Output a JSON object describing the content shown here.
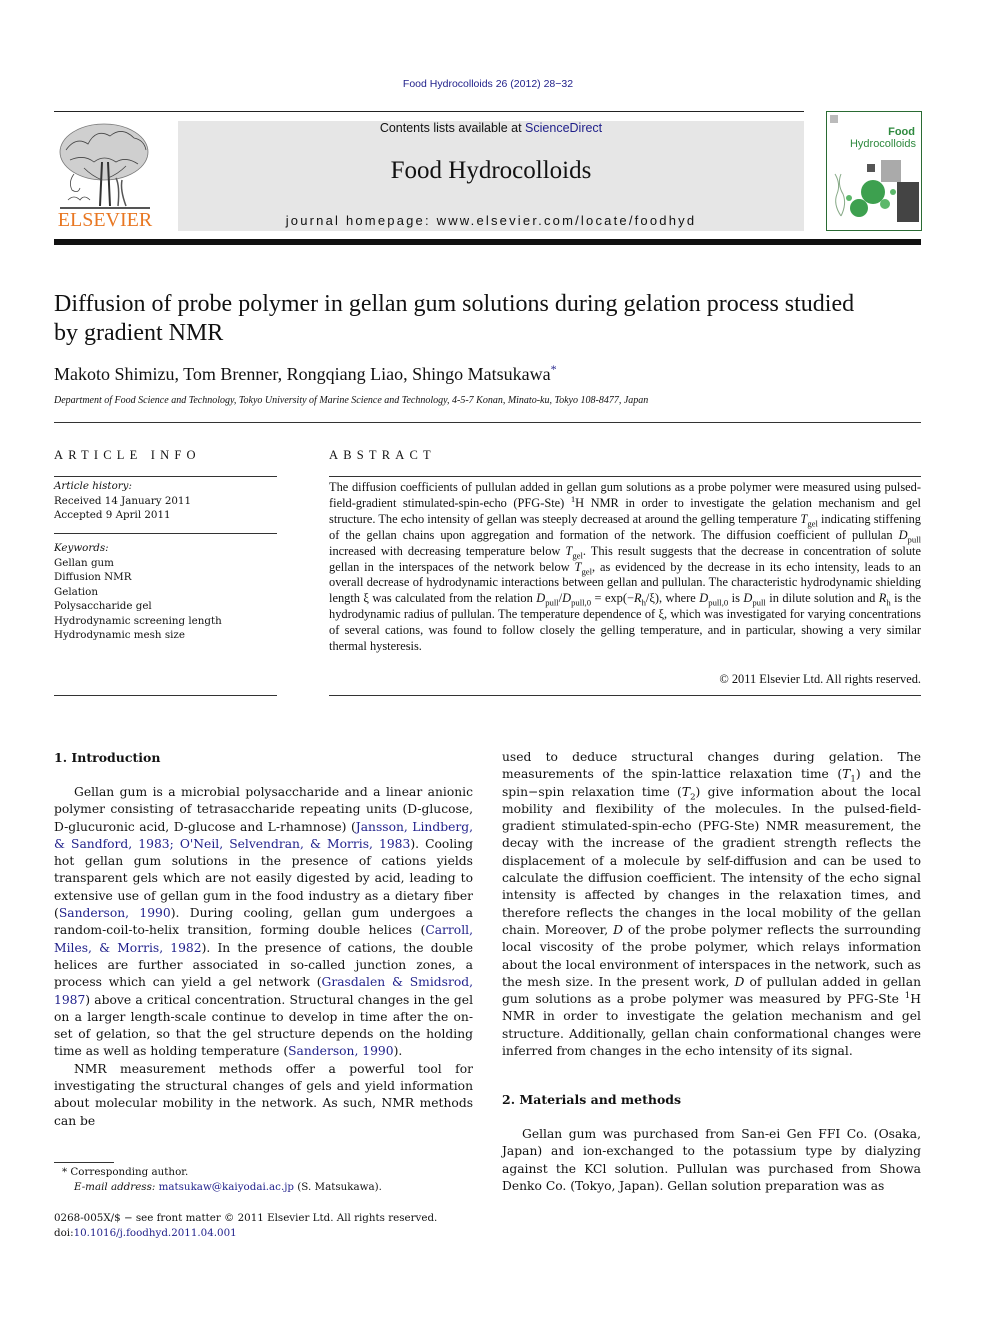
{
  "header": {
    "citation": "Food Hydrocolloids 26 (2012) 28−32",
    "contents_prefix": "Contents lists available at ",
    "contents_link": "ScienceDirect",
    "journal_title": "Food Hydrocolloids",
    "homepage": "journal homepage: www.elsevier.com/locate/foodhyd",
    "publisher_logo_text": "ELSEVIER",
    "cover_title_line1": "Food",
    "cover_title_line2": "Hydrocolloids"
  },
  "article": {
    "title": "Diffusion of probe polymer in gellan gum solutions during gelation process studied by gradient NMR",
    "authors": "Makoto Shimizu, Tom Brenner, Rongqiang Liao, Shingo Matsukawa",
    "corresponding_mark": "*",
    "affiliation": "Department of Food Science and Technology, Tokyo University of Marine Science and Technology, 4-5-7 Konan, Minato-ku, Tokyo 108-8477, Japan"
  },
  "article_info": {
    "label": "ARTICLE INFO",
    "history_label": "Article history:",
    "received": "Received 14 January 2011",
    "accepted": "Accepted 9 April 2011",
    "keywords_label": "Keywords:",
    "keywords": [
      "Gellan gum",
      "Diffusion NMR",
      "Gelation",
      "Polysaccharide gel",
      "Hydrodynamic screening length",
      "Hydrodynamic mesh size"
    ]
  },
  "abstract": {
    "label": "ABSTRACT",
    "s1": "The diffusion coefficients of pullulan added in gellan gum solutions as a probe polymer were measured using pulsed-field-gradient stimulated-spin-echo (PFG-Ste) ",
    "s1_sup": "1",
    "s2": "H NMR in order to investigate the gelation mechanism and gel structure. The echo intensity of gellan was steeply decreased at around the gelling temperature ",
    "s3": " indicating stiffening of the gellan chains upon aggregation and formation of the network. The diffusion coefficient of pullulan ",
    "s4": " increased with decreasing temperature below ",
    "s5": ". This result suggests that the decrease in concentration of solute gellan in the interspaces of the network below ",
    "s6": ", as evidenced by the decrease in its echo intensity, leads to an overall decrease of hydrodynamic interactions between gellan and pullulan. The characteristic hydrodynamic shielding length ξ was calculated from the relation ",
    "s7": ", where ",
    "s8": " is ",
    "s9": " in dilute solution and ",
    "s10": " is the hydrodynamic radius of pullulan. The temperature dependence of ξ, which was investigated for varying concentrations of several cations, was found to follow closely the gelling temperature, and in particular, showing a very similar thermal hysteresis.",
    "sym_T": "T",
    "sub_gel": "gel",
    "sym_D": "D",
    "sub_pull": "pull",
    "sub_pull0": "pull,0",
    "relation_mid": " = exp(−",
    "relation_end": "/ξ)",
    "sym_R": "R",
    "sub_h": "h",
    "copyright": "© 2011 Elsevier Ltd. All rights reserved."
  },
  "intro": {
    "heading": "1.  Introduction",
    "p1_a": "Gellan gum is a microbial polysaccharide and a linear anionic polymer consisting of tetrasaccharide repeating units (D-glucose, D-glucuronic acid, D-glucose and L-rhamnose) (",
    "p1_ref1": "Jansson, Lindberg, & Sandford, 1983; O'Neil, Selvendran, & Morris, 1983",
    "p1_b": "). Cooling hot gellan gum solutions in the presence of cations yields transparent gels which are not easily digested by acid, leading to extensive use of gellan gum in the food industry as a dietary fiber (",
    "p1_ref2": "Sanderson, 1990",
    "p1_c": "). During cooling, gellan gum undergoes a random-coil-to-helix transition, forming double helices (",
    "p1_ref3": "Carroll, Miles, & Morris, 1982",
    "p1_d": "). In the presence of cations, the double helices are further associated in so-called junction zones, a process which can yield a gel network (",
    "p1_ref4": "Grasdalen & Smidsrod, 1987",
    "p1_e": ") above a critical concentration. Structural changes in the gel on a larger length-scale continue to develop in time after the on-set of gelation, so that the gel structure depends on the holding time as well as holding temperature (",
    "p1_ref5": "Sanderson, 1990",
    "p1_f": ").",
    "p2": "NMR measurement methods offer a powerful tool for investigating the structural changes of gels and yield information about molecular mobility in the network. As such, NMR methods can be",
    "p3_a": "used to deduce structural changes during gelation. The measurements of the spin-lattice relaxation time (",
    "p3_b": ") and the spin−spin relaxation time (",
    "p3_c": ") give information about the local mobility and flexibility of the molecules. In the pulsed-field-gradient stimulated-spin-echo (PFG-Ste) NMR measurement, the decay with the increase of the gradient strength reflects the displacement of a molecule by self-diffusion and can be used to calculate the diffusion coefficient. The intensity of the echo signal intensity is affected by changes in the relaxation times, and therefore reflects the changes in the local mobility of the gellan chain. Moreover, ",
    "p3_d": " of the probe polymer reflects the surrounding local viscosity of the probe polymer, which relays information about the local environment of interspaces in the network, such as the mesh size. In the present work, ",
    "p3_e": " of pullulan added in gellan gum solutions as a probe polymer was measured by PFG-Ste ",
    "p3_f": "H NMR in order to investigate the gelation mechanism and gel structure. Additionally, gellan chain conformational changes were inferred from changes in the echo intensity of its signal.",
    "sub_1": "1",
    "sub_2": "2",
    "sup_1": "1"
  },
  "methods": {
    "heading": "2.  Materials and methods",
    "p1": "Gellan gum was purchased from San-ei Gen FFI Co. (Osaka, Japan) and ion-exchanged to the potassium type by dialyzing against the KCl solution. Pullulan was purchased from Showa Denko Co. (Tokyo, Japan). Gellan solution preparation was as"
  },
  "footnotes": {
    "corresponding": "* Corresponding author.",
    "email_label": "E-mail address:",
    "email": "matsukaw@kaiyodai.ac.jp",
    "email_suffix": " (S. Matsukawa).",
    "front_matter": "0268-005X/$ − see front matter © 2011 Elsevier Ltd. All rights reserved.",
    "doi_prefix": "doi:",
    "doi": "10.1016/j.foodhyd.2011.04.001"
  }
}
